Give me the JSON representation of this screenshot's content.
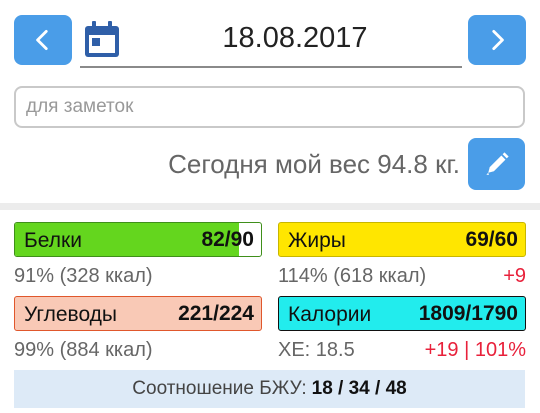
{
  "header": {
    "date": "18.08.2017",
    "prev_icon": "chevron-left-icon",
    "next_icon": "chevron-right-icon",
    "calendar_icon": "calendar-icon"
  },
  "notes": {
    "placeholder": "для заметок",
    "value": ""
  },
  "weight": {
    "text": "Сегодня мой вес 94.8 кг.",
    "edit_icon": "pencil-icon"
  },
  "nutrients": {
    "protein": {
      "label": "Белки",
      "value": "82/90",
      "percent_text": "91% (328 ккал)",
      "fill": 0.91
    },
    "fat": {
      "label": "Жиры",
      "value": "69/60",
      "percent_text": "114% (618 ккал)",
      "delta": "+9"
    },
    "carbs": {
      "label": "Углеводы",
      "value": "221/224",
      "percent_text": "99% (884 ккал)"
    },
    "calories": {
      "label": "Калории",
      "value": "1809/1790",
      "xe_text": "ХЕ: 18.5",
      "delta": "+19 | 101%"
    }
  },
  "ratio": {
    "label": "Соотношение БЖУ:",
    "value": "18 / 34 / 48"
  },
  "colors": {
    "accent": "#4a9de8",
    "protein": "#64d61e",
    "fat": "#ffe600",
    "carbs": "#f9c9b6",
    "calories": "#22eced",
    "over": "#e8213b"
  }
}
